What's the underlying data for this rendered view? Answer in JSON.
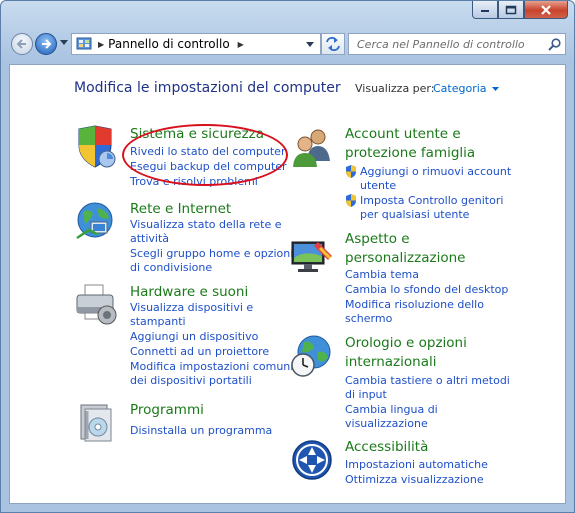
{
  "window": {
    "buttons": {
      "minimize": "minimize-icon",
      "maximize": "maximize-icon",
      "close": "close-icon"
    }
  },
  "navigation": {
    "breadcrumb": "Pannello di controllo",
    "search_placeholder": "Cerca nel Pannello di controllo"
  },
  "page": {
    "heading": "Modifica le impostazioni del computer",
    "view_by_label": "Visualizza per:",
    "view_by_value": "Categoria"
  },
  "categories": {
    "system": {
      "title": "Sistema e sicurezza",
      "links": [
        "Rivedi lo stato del computer",
        "Esegui backup del computer",
        "Trova e risolvi problemi"
      ]
    },
    "network": {
      "title": "Rete e Internet",
      "links": [
        "Visualizza stato della rete e",
        "attività",
        "Scegli gruppo home e opzioni",
        "di condivisione"
      ]
    },
    "hardware": {
      "title": "Hardware e suoni",
      "links": [
        "Visualizza dispositivi e",
        "stampanti",
        "Aggiungi un dispositivo",
        "Connetti ad un proiettore",
        "Modifica impostazioni comuni",
        "dei dispositivi portatili"
      ]
    },
    "programs": {
      "title": "Programmi",
      "links": [
        "Disinstalla un programma"
      ]
    },
    "accounts": {
      "title_line1": "Account utente e",
      "title_line2": "protezione famiglia",
      "links": [
        "Aggiungi o rimuovi account",
        "utente",
        "Imposta Controllo genitori",
        "per qualsiasi utente"
      ]
    },
    "appearance": {
      "title_line1": "Aspetto e",
      "title_line2": "personalizzazione",
      "links": [
        "Cambia tema",
        "Cambia lo sfondo del desktop",
        "Modifica risoluzione dello",
        "schermo"
      ]
    },
    "clock": {
      "title_line1": "Orologio e opzioni",
      "title_line2": "internazionali",
      "links": [
        "Cambia tastiere o altri metodi",
        "di input",
        "Cambia lingua di",
        "visualizzazione"
      ]
    },
    "access": {
      "title": "Accessibilità",
      "links": [
        "Impostazioni automatiche",
        "Ottimizza visualizzazione"
      ]
    }
  },
  "colors": {
    "heading": "#1e3287",
    "category_title": "#1a7a1a",
    "link": "#1e50c8",
    "highlight_oval": "#d8101c"
  }
}
